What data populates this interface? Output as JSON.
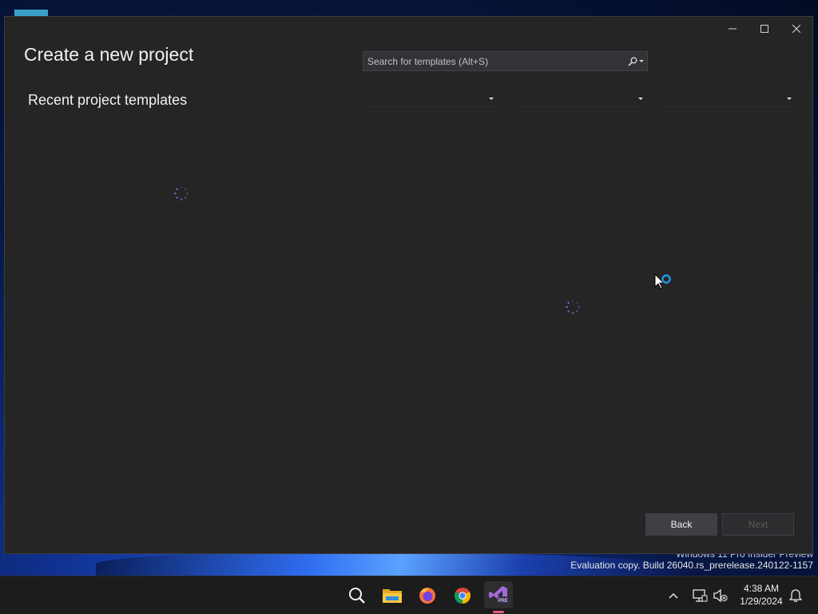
{
  "dialog": {
    "title": "Create a new project",
    "recent_heading": "Recent project templates",
    "search_placeholder": "Search for templates (Alt+S)",
    "back_label": "Back",
    "next_label": "Next",
    "window_controls": [
      "minimize-icon",
      "maximize-icon",
      "close-icon"
    ]
  },
  "filters": [
    {
      "value": ""
    },
    {
      "value": ""
    },
    {
      "value": ""
    }
  ],
  "watermark": {
    "line1": "Windows 11 Pro Insider Preview",
    "line2": "Evaluation copy. Build 26040.rs_prerelease.240122-1157"
  },
  "taskbar": {
    "apps": [
      "search-icon",
      "file-explorer-icon",
      "firefox-icon",
      "chrome-icon",
      "visual-studio-preview-icon"
    ],
    "active_app": "visual-studio-preview-icon",
    "tray_icons": [
      "chevron-up-icon",
      "network-icon",
      "volume-muted-icon",
      "notification-bell-icon"
    ],
    "time": "4:38 AM",
    "date": "1/29/2024"
  }
}
